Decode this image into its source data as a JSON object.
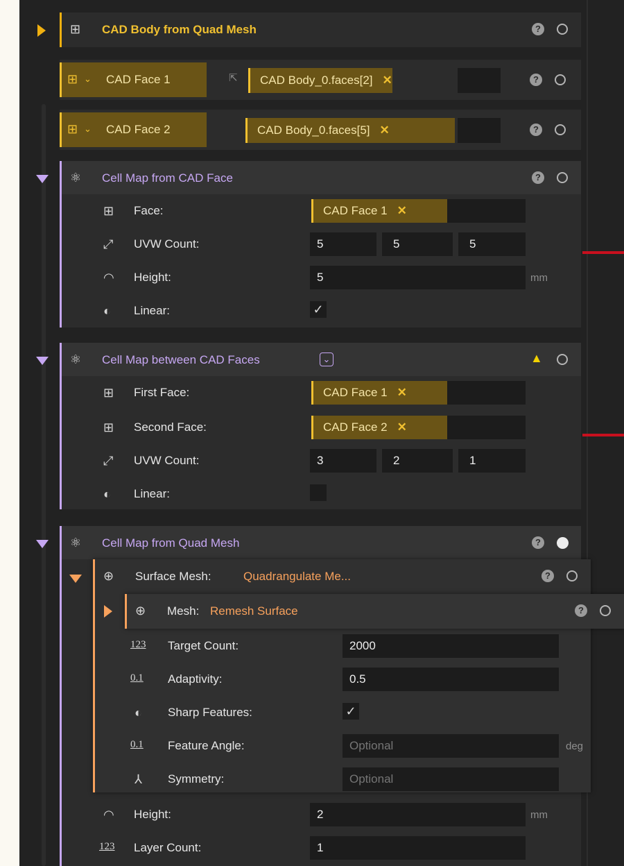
{
  "nodes": {
    "cad_body": {
      "title": "CAD Body from Quad Mesh"
    },
    "cad_face1": {
      "label": "CAD Face 1",
      "chip": "CAD Body_0.faces[2]"
    },
    "cad_face2": {
      "label": "CAD Face 2",
      "chip": "CAD Body_0.faces[5]"
    },
    "cellmap_face": {
      "title": "Cell Map from CAD Face",
      "face_label": "Face:",
      "face_value": "CAD Face 1",
      "uvw_label": "UVW Count:",
      "uvw": [
        "5",
        "5",
        "5"
      ],
      "height_label": "Height:",
      "height_value": "5",
      "height_unit": "mm",
      "linear_label": "Linear:",
      "linear_checked": true
    },
    "cellmap_between": {
      "title": "Cell Map between CAD Faces",
      "first_label": "First Face:",
      "first_value": "CAD Face 1",
      "second_label": "Second Face:",
      "second_value": "CAD Face 2",
      "uvw_label": "UVW Count:",
      "uvw": [
        "3",
        "2",
        "1"
      ],
      "linear_label": "Linear:",
      "linear_checked": false
    },
    "cellmap_quad": {
      "title": "Cell Map from Quad Mesh",
      "height_label": "Height:",
      "height_value": "2",
      "height_unit": "mm",
      "layer_label": "Layer Count:",
      "layer_value": "1"
    },
    "surface_mesh": {
      "label": "Surface Mesh:",
      "value": "Quadrangulate Me..."
    },
    "remesh": {
      "label": "Mesh:",
      "value": "Remesh Surface",
      "target_label": "Target Count:",
      "target_value": "2000",
      "adapt_label": "Adaptivity:",
      "adapt_value": "0.5",
      "sharp_label": "Sharp Features:",
      "sharp_checked": true,
      "angle_label": "Feature Angle:",
      "angle_placeholder": "Optional",
      "angle_unit": "deg",
      "sym_label": "Symmetry:",
      "sym_placeholder": "Optional"
    }
  },
  "icons": {
    "help": "?",
    "close": "✕",
    "check": "✓",
    "warning": "▲",
    "num_123": "123",
    "num_01": "0.1"
  },
  "colors": {
    "gold": "#f0c030",
    "purple": "#c6a7f2",
    "orange": "#f7a15c",
    "warning": "#f2d200",
    "connector_red": "#c8101e"
  }
}
